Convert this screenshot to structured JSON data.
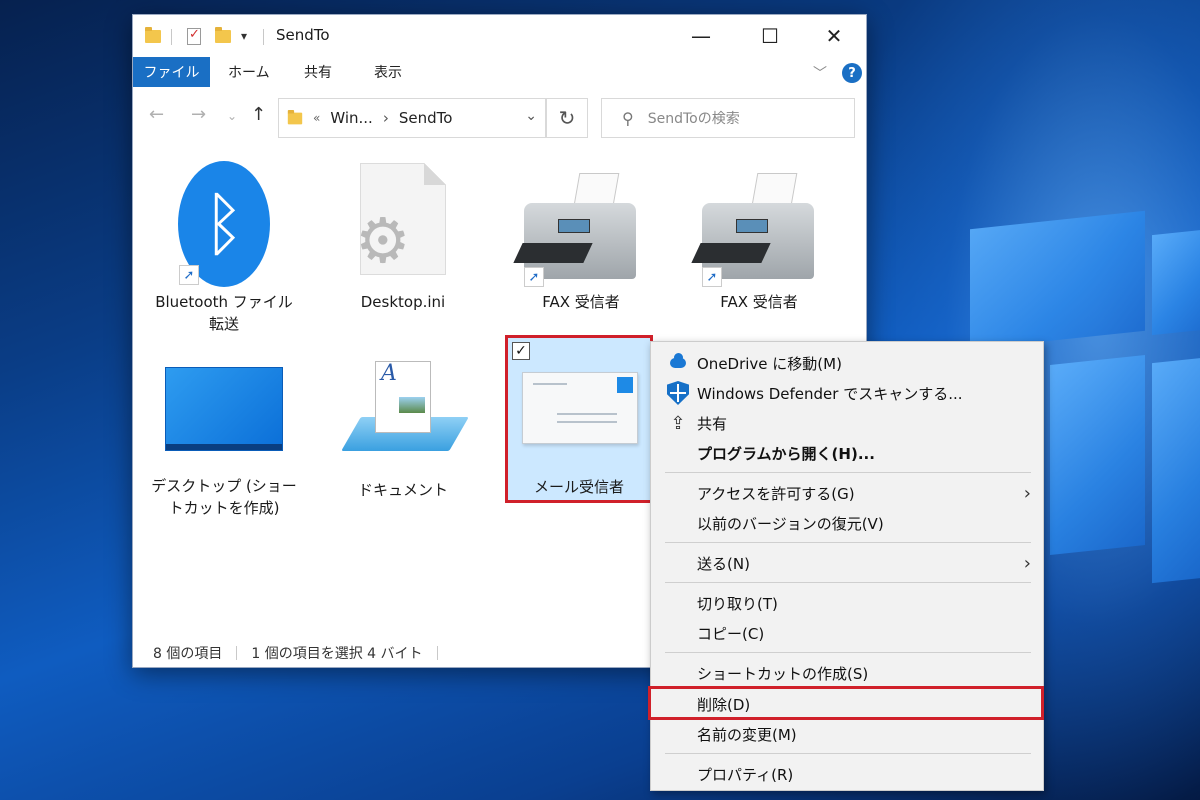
{
  "window": {
    "title": "SendTo",
    "controls": {
      "minimize": "—",
      "maximize": "☐",
      "close": "✕"
    }
  },
  "ribbon": {
    "tabs": [
      "ファイル",
      "ホーム",
      "共有",
      "表示"
    ],
    "help": "?"
  },
  "nav": {
    "address": {
      "prefix": "«",
      "crumb1": "Win...",
      "separator": "›",
      "crumb2": "SendTo"
    },
    "search_placeholder": "SendToの検索"
  },
  "items": [
    {
      "label_line1": "Bluetooth ファイル",
      "label_line2": "転送",
      "icon": "bluetooth-icon",
      "shortcut": true
    },
    {
      "label_line1": "Desktop.ini",
      "label_line2": "",
      "icon": "settings-file-icon",
      "shortcut": false
    },
    {
      "label_line1": "FAX 受信者",
      "label_line2": "",
      "icon": "fax-icon",
      "shortcut": true
    },
    {
      "label_line1": "FAX 受信者",
      "label_line2": "",
      "icon": "fax-icon",
      "shortcut": true
    },
    {
      "label_line1": "デスクトップ (ショー",
      "label_line2": "トカットを作成)",
      "icon": "desktop-icon",
      "shortcut": false
    },
    {
      "label_line1": "ドキュメント",
      "label_line2": "",
      "icon": "document-icon",
      "shortcut": false
    },
    {
      "label_line1": "メール受信者",
      "label_line2": "",
      "icon": "mail-icon",
      "shortcut": false,
      "selected": true
    }
  ],
  "status": {
    "count": "8 個の項目",
    "selection": "1 個の項目を選択  4 バイト"
  },
  "context_menu": {
    "items": [
      {
        "label": "OneDrive に移動(M)",
        "icon": "onedrive-cloud-icon"
      },
      {
        "label": "Windows Defender でスキャンする...",
        "icon": "defender-shield-icon"
      },
      {
        "label": "共有",
        "icon": "share-icon"
      },
      {
        "label": "プログラムから開く(H)...",
        "bold": true
      },
      {
        "label": "アクセスを許可する(G)",
        "submenu": true
      },
      {
        "label": "以前のバージョンの復元(V)"
      },
      {
        "label": "送る(N)",
        "submenu": true
      },
      {
        "label": "切り取り(T)"
      },
      {
        "label": "コピー(C)"
      },
      {
        "label": "ショートカットの作成(S)"
      },
      {
        "label": "削除(D)",
        "highlighted": true
      },
      {
        "label": "名前の変更(M)"
      },
      {
        "label": "プロパティ(R)"
      }
    ]
  },
  "colors": {
    "accent": "#1a6fc4",
    "highlight_box": "#d0202a",
    "selection_bg": "#cce8ff"
  }
}
